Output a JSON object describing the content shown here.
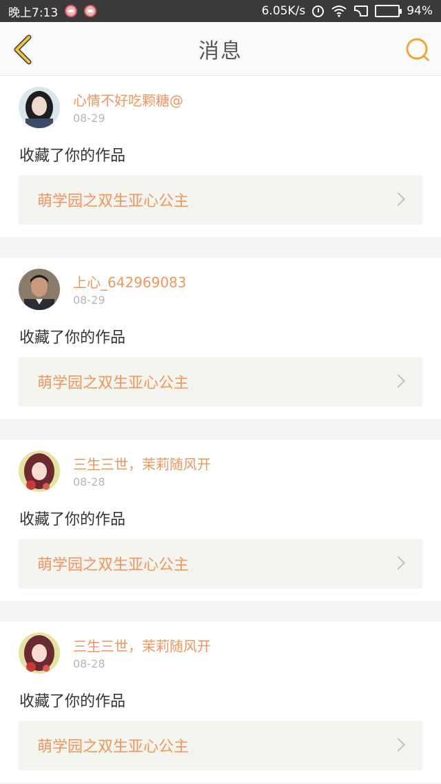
{
  "status_bar": {
    "time": "晚上7:13",
    "speed": "6.05K/s",
    "battery": "94%",
    "battery_level": 0.94
  },
  "header": {
    "title": "消息",
    "accent_color": "#f2a23a"
  },
  "messages": [
    {
      "username": "心情不好吃颗糖@",
      "date": "08-29",
      "action": "收藏了你的作品",
      "work_title": "萌学园之双生亚心公主",
      "avatar_icon": "avatar-girl-dark-hair"
    },
    {
      "username": "上心_642969083",
      "date": "08-29",
      "action": "收藏了你的作品",
      "work_title": "萌学园之双生亚心公主",
      "avatar_icon": "avatar-man-photo"
    },
    {
      "username": "三生三世，茉莉随风开",
      "date": "08-28",
      "action": "收藏了你的作品",
      "work_title": "萌学园之双生亚心公主",
      "avatar_icon": "avatar-anime-girl"
    },
    {
      "username": "三生三世，茉莉随风开",
      "date": "08-28",
      "action": "收藏了你的作品",
      "work_title": "萌学园之双生亚心公主",
      "avatar_icon": "avatar-anime-girl"
    }
  ]
}
